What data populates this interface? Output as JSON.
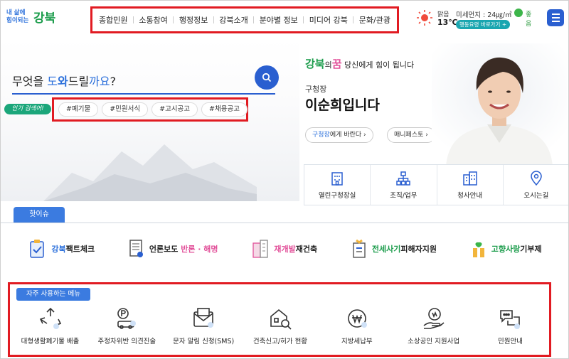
{
  "header": {
    "logo_small": "내 삶에\n힘이되는",
    "logo_text": "강북",
    "nav": [
      "종합민원",
      "소통참여",
      "행정정보",
      "강북소개",
      "분야별 정보",
      "미디어 강북",
      "문화/관광"
    ],
    "weather": {
      "condition": "맑음",
      "temperature": "13℃",
      "dust_label": "미세먼지 : 24㎍/㎥",
      "dust_status": "좋음",
      "action_button": "행동요령 바로가기 +"
    }
  },
  "hero": {
    "question_prefix": "무엇을 ",
    "question_a": "도",
    "question_b": "와",
    "question_c": "드릴",
    "question_d": "까요",
    "question_e": "?",
    "popular_label": "인기 검색어!",
    "tags": [
      "#폐기물",
      "#민원서식",
      "#고시공고",
      "#채용공고"
    ]
  },
  "mayor": {
    "slogan_gb": "강북",
    "slogan_ui": "의",
    "slogan_dream": "꿈",
    "slogan_rest": " 당신에게 힘이 됩니다",
    "role": "구청장",
    "name": "이순희입니다",
    "pill1_bold": "구청장",
    "pill1_rest": "에게 바란다 ›",
    "pill2": "매니페스토 ›"
  },
  "quick_links": [
    {
      "label": "열린구청장실",
      "icon": "building-icon"
    },
    {
      "label": "조직/업무",
      "icon": "org-chart-icon"
    },
    {
      "label": "청사안내",
      "icon": "office-building-icon"
    },
    {
      "label": "오시는길",
      "icon": "location-pin-icon"
    }
  ],
  "hot_issue": {
    "tab": "핫이슈",
    "items": [
      {
        "a": "강북",
        "b": "팩트체크",
        "icon": "checklist-icon"
      },
      {
        "a": "언론보도 ",
        "b": "반론 · 해명",
        "icon": "document-icon"
      },
      {
        "a": "재개발",
        "b": "재건축",
        "icon": "apartment-icon"
      },
      {
        "a": "전세사기",
        "b": "피해자지원",
        "icon": "house-document-icon"
      },
      {
        "a": "고향사랑",
        "b": "기부제",
        "icon": "gift-plant-icon"
      }
    ]
  },
  "frequent": {
    "tab": "자주 사용하는 메뉴",
    "items": [
      {
        "label": "대형생활폐기물 배출",
        "icon": "recycle-icon"
      },
      {
        "label": "주정차위반 의견진술",
        "icon": "parking-icon"
      },
      {
        "label": "문자 알림 신청(SMS)",
        "icon": "mail-icon"
      },
      {
        "label": "건축신고/허가 현황",
        "icon": "building-search-icon"
      },
      {
        "label": "지방세납부",
        "icon": "won-coin-icon"
      },
      {
        "label": "소상공인 지원사업",
        "icon": "hand-coin-icon"
      },
      {
        "label": "민원안내",
        "icon": "chat-bubbles-icon"
      }
    ]
  },
  "colors": {
    "accent": "#2a5fd0",
    "green": "#1b9c4b",
    "highlight": "#e11b22"
  }
}
